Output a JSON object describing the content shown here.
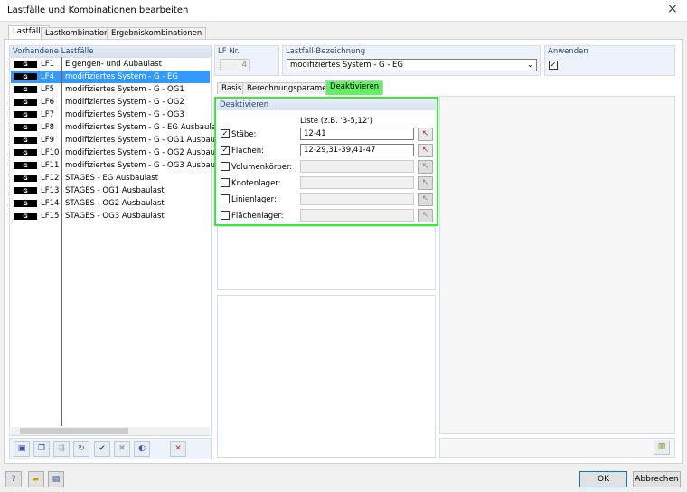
{
  "window": {
    "title": "Lastfälle und Kombinationen bearbeiten",
    "close": "×"
  },
  "tabs": [
    "Lastfälle",
    "Lastkombinationen",
    "Ergebniskombinationen"
  ],
  "list": {
    "header": "Vorhandene Lastfälle",
    "badge": "G",
    "selected_index": 1,
    "items": [
      {
        "id": "LF1",
        "name": "Eigengen- und Aubaulast"
      },
      {
        "id": "LF4",
        "name": "modifiziertes System - G - EG"
      },
      {
        "id": "LF5",
        "name": "modifiziertes System - G - OG1"
      },
      {
        "id": "LF6",
        "name": "modifiziertes System - G - OG2"
      },
      {
        "id": "LF7",
        "name": "modifiziertes System - G - OG3"
      },
      {
        "id": "LF8",
        "name": "modifiziertes System - G - EG Ausbaulast"
      },
      {
        "id": "LF9",
        "name": "modifiziertes System - G - OG1 Ausbaulast"
      },
      {
        "id": "LF10",
        "name": "modifiziertes System - G - OG2 Ausbaulast"
      },
      {
        "id": "LF11",
        "name": "modifiziertes System - G - OG3 Ausbaulast"
      },
      {
        "id": "LF12",
        "name": "STAGES - EG Ausbaulast"
      },
      {
        "id": "LF13",
        "name": "STAGES - OG1 Ausbaulast"
      },
      {
        "id": "LF14",
        "name": "STAGES - OG2 Ausbaulast"
      },
      {
        "id": "LF15",
        "name": "STAGES - OG3 Ausbaulast"
      }
    ]
  },
  "lfnr": {
    "label": "LF Nr.",
    "value": "4"
  },
  "bezeichnung": {
    "label": "Lastfall-Bezeichnung",
    "value": "modifiziertes System - G - EG"
  },
  "anwenden": {
    "label": "Anwenden",
    "checked": true,
    "check": "✓"
  },
  "subtabs": [
    "Basis",
    "Berechnungsparameter",
    "Deaktivieren"
  ],
  "deaktivieren": {
    "title": "Deaktivieren",
    "list_hint": "Liste (z.B. '3-5,12')",
    "rows": [
      {
        "label": "Stäbe:",
        "checked": true,
        "value": "12-41"
      },
      {
        "label": "Flächen:",
        "checked": true,
        "value": "12-29,31-39,41-47"
      },
      {
        "label": "Volumenkörper:",
        "checked": false,
        "value": ""
      },
      {
        "label": "Knotenlager:",
        "checked": false,
        "value": ""
      },
      {
        "label": "Linienlager:",
        "checked": false,
        "value": ""
      },
      {
        "label": "Flächenlager:",
        "checked": false,
        "value": ""
      }
    ]
  },
  "colors": {
    "accent": "#3399ff",
    "highlight": "#33ee33",
    "delete": "#dd2222"
  },
  "buttons": {
    "ok": "OK",
    "cancel": "Abbrechen"
  }
}
